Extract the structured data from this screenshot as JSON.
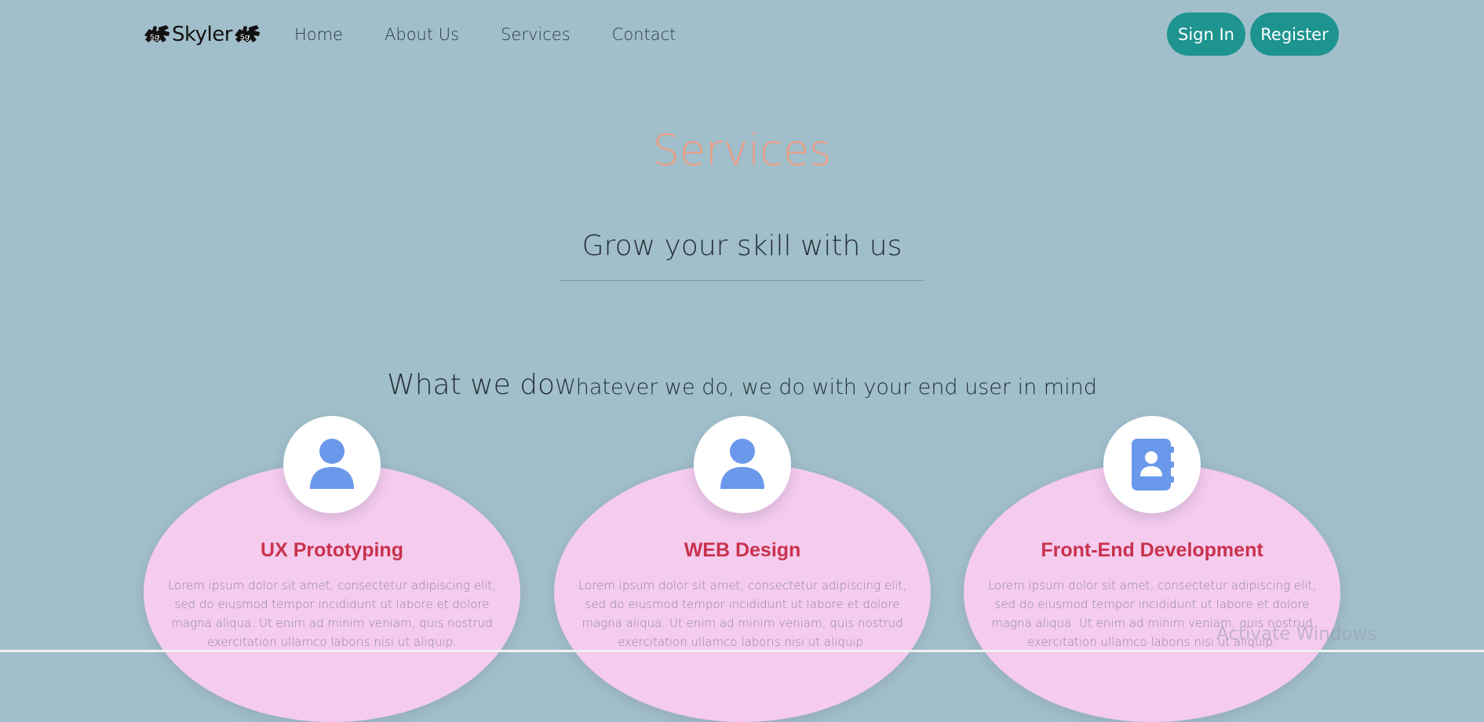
{
  "brand": {
    "name": "Skyler"
  },
  "nav": {
    "links": [
      "Home",
      "About Us",
      "Services",
      "Contact"
    ],
    "sign_in": "Sign In",
    "register": "Register"
  },
  "hero": {
    "title": "Services",
    "subtitle": "Grow your skill with us"
  },
  "what_we_do": {
    "heading": "What we do",
    "tagline": "Whatever we do, we do with your end user in mind"
  },
  "cards": [
    {
      "icon": "user-icon",
      "title": "UX Prototyping",
      "text": "Lorem ipsum dolor sit amet, consectetur adipiscing elit, sed do eiusmod tempor incididunt ut labore et dolore magna aliqua. Ut enim ad minim veniam, quis nostrud exercitation ullamco laboris nisi ut aliquip."
    },
    {
      "icon": "user-icon",
      "title": "WEB Design",
      "text": "Lorem ipsum dolor sit amet, consectetur adipiscing elit, sed do eiusmod tempor incididunt ut labore et dolore magna aliqua. Ut enim ad minim veniam, quis nostrud exercitation ullamco laboris nisi ut aliquip."
    },
    {
      "icon": "address-book-icon",
      "title": "Front-End Development",
      "text": "Lorem ipsum dolor sit amet, consectetur adipiscing elit, sed do eiusmod tempor incididunt ut labore et dolore magna aliqua. Ut enim ad minim veniam, quis nostrud exercitation ullamco laboris nisi ut aliquip."
    }
  ],
  "watermark": "Activate Windows",
  "colors": {
    "background": "#a1bfcb",
    "accent_button": "#1e9490",
    "title": "#ee9b80",
    "card": "#f5cbee",
    "card_title": "#c8324d",
    "icon": "#6a98ea"
  }
}
